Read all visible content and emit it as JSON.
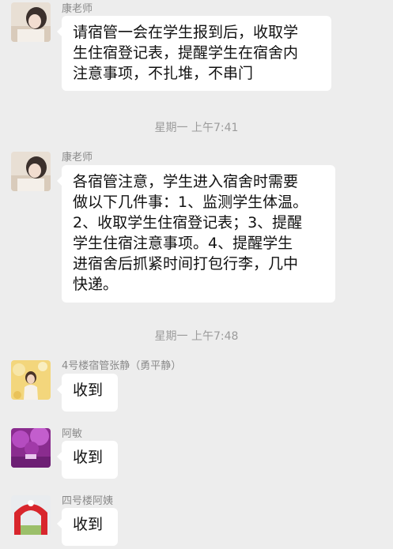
{
  "messages": [
    {
      "sender": "康老师",
      "lines": [
        "请宿管一会在学生报到后，收取学",
        "生住宿登记表，提醒学生在宿舍内",
        "注意事项，不扎堆，不串门"
      ]
    },
    {
      "sender": "康老师",
      "lines": [
        "各宿管注意，学生进入宿舍时需要",
        "做以下几件事：1、监测学生体温。",
        "2、收取学生住宿登记表；3、提醒",
        "学生住宿注意事项。4、提醒学生",
        "进宿舍后抓紧时间打包行李，几中",
        "快递。"
      ]
    },
    {
      "sender": "4号楼宿管张静（勇平静）",
      "lines": [
        "收到"
      ]
    },
    {
      "sender": "阿敏",
      "lines": [
        "收到"
      ]
    },
    {
      "sender": "四号楼阿姨",
      "lines": [
        "收到"
      ]
    }
  ],
  "timestamps": [
    "星期一 上午7:41",
    "星期一 上午7:48"
  ]
}
